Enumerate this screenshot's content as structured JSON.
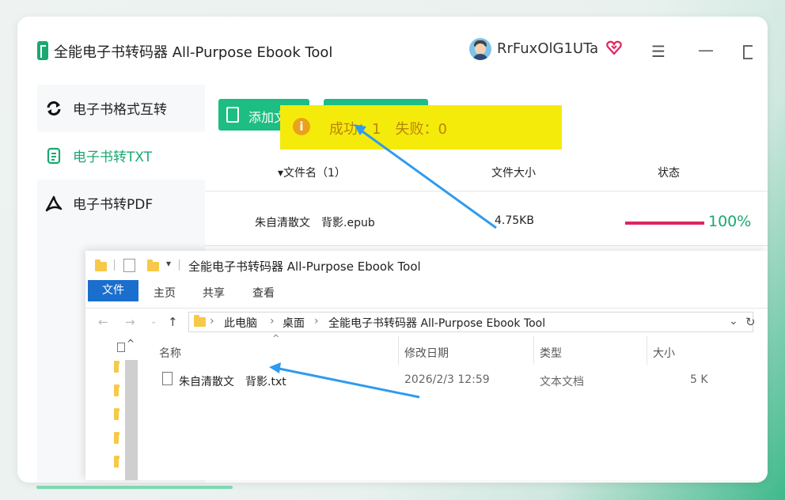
{
  "app": {
    "title": "全能电子书转码器 All-Purpose Ebook Tool",
    "username": "RrFuxOlG1UTa"
  },
  "sidebar": {
    "items": [
      {
        "label": "电子书格式互转"
      },
      {
        "label": "电子书转TXT"
      },
      {
        "label": "电子书转PDF"
      }
    ]
  },
  "toolbar": {
    "add_label": "添加文"
  },
  "table": {
    "headers": {
      "name": "▾文件名（1）",
      "size": "文件大小",
      "status": "状态"
    },
    "rows": [
      {
        "name": "朱自清散文　背影.epub",
        "size": "4.75KB",
        "progress": 1.0,
        "percent": "100%"
      }
    ]
  },
  "toast": {
    "message": "成功：1　失败：0"
  },
  "explorer": {
    "title": "全能电子书转码器 All-Purpose Ebook Tool",
    "ribbon_tabs": [
      "文件",
      "主页",
      "共享",
      "查看"
    ],
    "breadcrumbs": [
      "此电脑",
      "桌面",
      "全能电子书转码器 All-Purpose Ebook Tool"
    ],
    "columns": [
      "名称",
      "修改日期",
      "类型",
      "大小"
    ],
    "files": [
      {
        "name": "朱自清散文　背影.txt",
        "modified": "2026/2/3 12:59",
        "type": "文本文档",
        "size": "5 K"
      }
    ]
  },
  "colors": {
    "brand": "#1aa871",
    "button": "#1dbd83",
    "progress": "#e0245e",
    "toast_bg": "#f5eb0b",
    "toast_text": "#b8860b",
    "arrow": "#2f9bef"
  },
  "icons": {
    "sidebar": [
      "convert-icon",
      "txt-icon",
      "pdf-icon"
    ],
    "toast": "info-icon"
  }
}
